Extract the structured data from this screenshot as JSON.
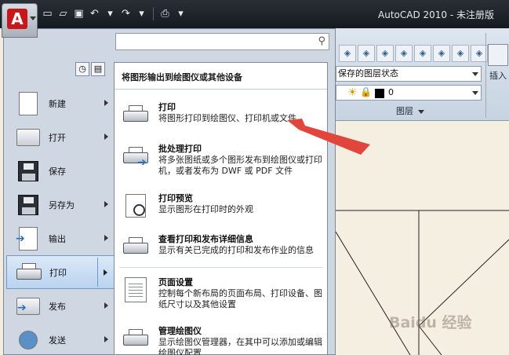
{
  "window": {
    "title": "AutoCAD 2010 - 未注册版"
  },
  "app_button": {
    "logo": "A"
  },
  "quick_access": {
    "icons": [
      "new-icon",
      "open-icon",
      "save-icon",
      "undo-icon",
      "redo-icon",
      "plot-icon"
    ]
  },
  "ribbon": {
    "layer_state": "保存的图层状态",
    "layer_name": "0",
    "layer_panel": "图层",
    "insert_label": "插入"
  },
  "app_menu": {
    "search_placeholder": "",
    "items": [
      {
        "label": "新建",
        "icon": "new-document-icon"
      },
      {
        "label": "打开",
        "icon": "open-folder-icon"
      },
      {
        "label": "保存",
        "icon": "save-disk-icon"
      },
      {
        "label": "另存为",
        "icon": "save-as-icon"
      },
      {
        "label": "输出",
        "icon": "export-icon"
      },
      {
        "label": "打印",
        "icon": "printer-icon"
      },
      {
        "label": "发布",
        "icon": "publish-icon"
      },
      {
        "label": "发送",
        "icon": "send-icon"
      }
    ]
  },
  "flyout": {
    "heading": "将图形输出到绘图仪或其他设备",
    "items": [
      {
        "title": "打印",
        "desc": "将图形打印到绘图仪、打印机或文件"
      },
      {
        "title": "批处理打印",
        "desc": "将多张图纸或多个图形发布到绘图仪或打印机，或者发布为 DWF 或 PDF 文件"
      },
      {
        "title": "打印预览",
        "desc": "显示图形在打印时的外观"
      },
      {
        "title": "查看打印和发布详细信息",
        "desc": "显示有关已完成的打印和发布作业的信息"
      },
      {
        "title": "页面设置",
        "desc": "控制每个新布局的页面布局、打印设备、图纸尺寸以及其他设置"
      },
      {
        "title": "管理绘图仪",
        "desc": "显示绘图仪管理器，在其中可以添加或编辑绘图仪配置"
      }
    ]
  },
  "annotation": {
    "color": "#e0463c"
  },
  "watermark": "Baidu 经验"
}
